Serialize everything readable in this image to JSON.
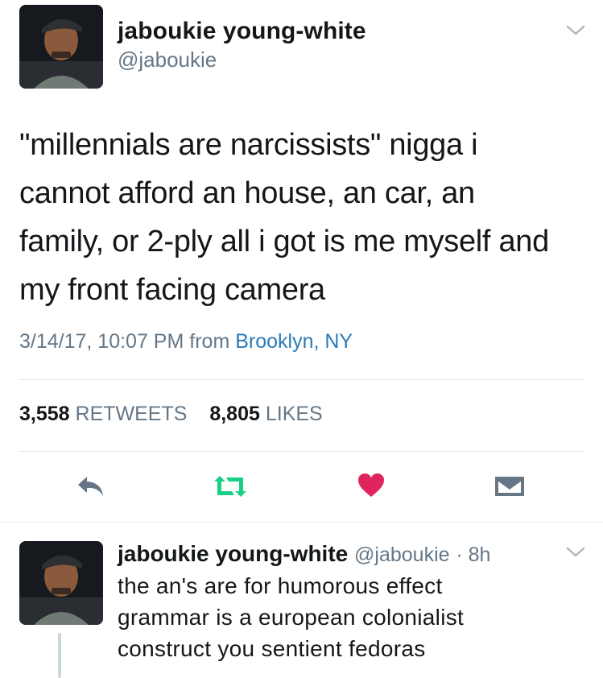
{
  "tweet": {
    "author_name": "jaboukie young-white",
    "author_handle": "@jaboukie",
    "text_lines": [
      "\"millennials are narcissists\" nigga i",
      "cannot afford an house, an car, an",
      "family, or 2-ply all i got is me myself and",
      "my front facing camera"
    ],
    "timestamp": "3/14/17, 10:07 PM",
    "from_word": "from",
    "location": "Brooklyn, NY",
    "retweets_count": "3,558",
    "retweets_label": "RETWEETS",
    "likes_count": "8,805",
    "likes_label": "LIKES"
  },
  "actions": {
    "reply_icon": "reply-arrow-icon",
    "retweet_icon": "retweet-icon",
    "like_icon": "heart-icon",
    "dm_icon": "envelope-icon"
  },
  "reply": {
    "author_name": "jaboukie young-white",
    "author_handle": "@jaboukie",
    "age": "· 8h",
    "text_lines": [
      "the an's are for humorous effect",
      "grammar is a european colonialist",
      "construct you sentient fedoras"
    ]
  },
  "colors": {
    "text": "#14171a",
    "secondary": "#657786",
    "link": "#2b7bb9",
    "retweet_green": "#19cf86",
    "like_red": "#e0245e",
    "divider": "#e1e8ed"
  }
}
